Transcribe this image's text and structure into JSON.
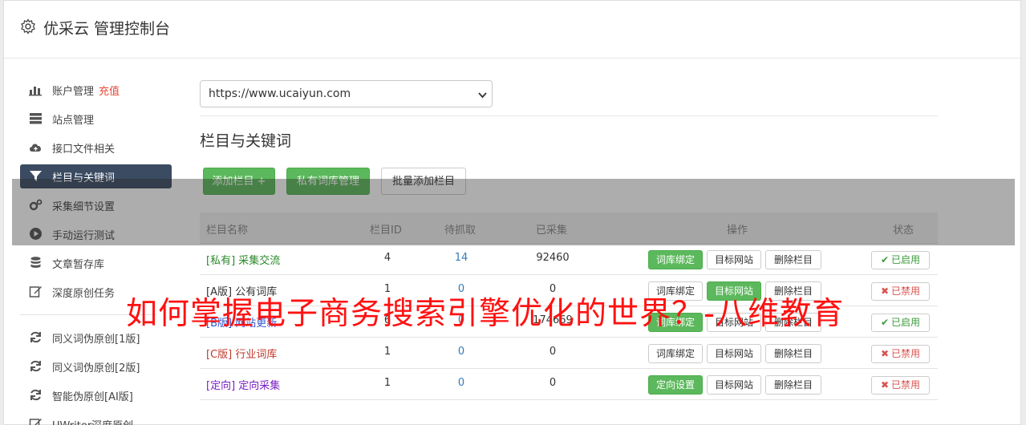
{
  "header": {
    "title": "优采云 管理控制台",
    "icon": "gear-icon"
  },
  "sidebar": {
    "items": [
      {
        "label": "账户管理",
        "extra": "充值",
        "icon": "bar-chart-icon"
      },
      {
        "label": "站点管理",
        "icon": "server-icon"
      },
      {
        "label": "接口文件相关",
        "icon": "cloud-upload-icon"
      },
      {
        "label": "栏目与关键词",
        "icon": "filter-icon",
        "active": true
      },
      {
        "label": "采集细节设置",
        "icon": "cogs-icon"
      },
      {
        "label": "手动运行测试",
        "icon": "play-circle-icon"
      },
      {
        "label": "文章暂存库",
        "icon": "database-icon"
      },
      {
        "label": "深度原创任务",
        "icon": "edit-icon"
      },
      {
        "label": "同义词伪原创[1版]",
        "icon": "refresh-icon"
      },
      {
        "label": "同义词伪原创[2版]",
        "icon": "refresh-icon"
      },
      {
        "label": "智能伪原创[AI版]",
        "icon": "refresh-icon"
      },
      {
        "label": "UWriter深度原创",
        "icon": "edit-icon"
      }
    ]
  },
  "main": {
    "site_select": {
      "value": "https://www.ucaiyun.com"
    },
    "section_title": "栏目与关键词",
    "toolbar": {
      "add_label": "添加栏目 +",
      "private_lib_label": "私有词库管理",
      "batch_add_label": "批量添加栏目"
    },
    "table": {
      "headers": {
        "name": "栏目名称",
        "id": "栏目ID",
        "pending": "待抓取",
        "collected": "已采集",
        "ops": "操作",
        "status": "状态"
      },
      "rows": [
        {
          "tag": "[私有]",
          "name": "采集交流",
          "id": "4",
          "pending": "14",
          "collected": "92460",
          "op1": "词库绑定",
          "op2": "目标网站",
          "op3": "删除栏目",
          "status": "已启用",
          "status_on": true,
          "color": "#2a8a2a",
          "op1_green": true,
          "op2_green": false
        },
        {
          "tag": "[A版]",
          "name": "公有词库",
          "id": "1",
          "pending": "0",
          "collected": "0",
          "op1": "词库绑定",
          "op2": "目标网站",
          "op3": "删除栏目",
          "status": "已禁用",
          "status_on": false,
          "color": "#333333",
          "op1_green": false,
          "op2_green": true
        },
        {
          "tag": "[B版]",
          "name": "网站更新",
          "id": "6",
          "pending": "0",
          "collected": "174669",
          "op1": "词库绑定",
          "op2": "目标网站",
          "op3": "删除栏目",
          "status": "已启用",
          "status_on": true,
          "color": "#3355cc",
          "op1_green": true,
          "op2_green": false
        },
        {
          "tag": "[C版]",
          "name": "行业词库",
          "id": "1",
          "pending": "0",
          "collected": "0",
          "op1": "词库绑定",
          "op2": "目标网站",
          "op3": "删除栏目",
          "status": "已禁用",
          "status_on": false,
          "color": "#c0392b",
          "op1_green": false,
          "op2_green": false
        },
        {
          "tag": "[定向]",
          "name": "定向采集",
          "id": "1",
          "pending": "0",
          "collected": "0",
          "op1": "定向设置",
          "op2": "目标网站",
          "op3": "删除栏目",
          "status": "已禁用",
          "status_on": false,
          "color": "#7a1fc4",
          "op1_green": true,
          "op2_green": false
        }
      ]
    }
  },
  "watermark": {
    "text": "如何掌握电子商务搜索引擎优化的世界？-八维教育"
  }
}
